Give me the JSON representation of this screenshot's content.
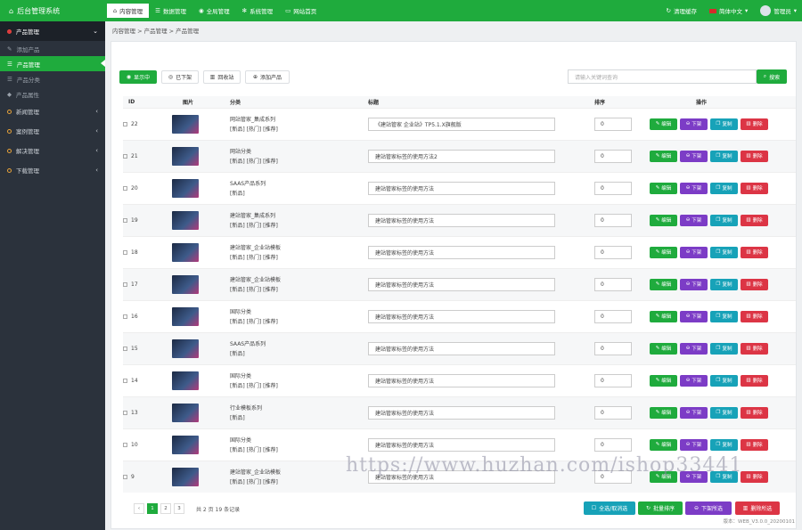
{
  "app_title": "后台管理系统",
  "top_nav": [
    {
      "label": "内容管理",
      "active": true
    },
    {
      "label": "数据管理",
      "active": false
    },
    {
      "label": "全局管理",
      "active": false
    },
    {
      "label": "系统管理",
      "active": false
    },
    {
      "label": "网站首页",
      "active": false
    }
  ],
  "top_right": {
    "clear_cache": "清理缓存",
    "language": "简体中文",
    "user": "管理员"
  },
  "sidebar": {
    "sections": [
      {
        "label": "产品管理",
        "open": true,
        "items": [
          {
            "label": "添加产品",
            "active": false
          },
          {
            "label": "产品管理",
            "active": true
          },
          {
            "label": "产品分类",
            "active": false
          },
          {
            "label": "产品属性",
            "active": false
          }
        ]
      },
      {
        "label": "新闻管理",
        "open": false,
        "items": []
      },
      {
        "label": "案例管理",
        "open": false,
        "items": []
      },
      {
        "label": "解决管理",
        "open": false,
        "items": []
      },
      {
        "label": "下载管理",
        "open": false,
        "items": []
      }
    ]
  },
  "breadcrumb": "内容管理  >  产品管理  >  产品管理",
  "toolbar": {
    "show": "显示中",
    "hidden": "已下架",
    "recycle": "回收站",
    "add": "添加产品"
  },
  "search": {
    "placeholder": "请输入关键词查询",
    "button": "搜索"
  },
  "table": {
    "columns": [
      "ID",
      "图片",
      "分类",
      "标题",
      "排序",
      "操作"
    ],
    "actions": {
      "edit": "编辑",
      "offline": "下架",
      "copy": "复制",
      "delete": "删除"
    },
    "rows": [
      {
        "id": "22",
        "category": "网站管家_集成系列",
        "tags": "[新品] [热门] [推荐]",
        "title": "《建站管家 企业站》TP5.1.X旗舰版",
        "sort": "0"
      },
      {
        "id": "21",
        "category": "网站分类",
        "tags": "[新品] [热门] [推荐]",
        "title": "建站管家标签的使用方法2",
        "sort": "0"
      },
      {
        "id": "20",
        "category": "SAAS产品系列",
        "tags": "[新品]",
        "title": "建站管家标签的使用方法",
        "sort": "0"
      },
      {
        "id": "19",
        "category": "建站管家_集成系列",
        "tags": "[新品] [热门] [推荐]",
        "title": "建站管家标签的使用方法",
        "sort": "0"
      },
      {
        "id": "18",
        "category": "建站管家_企业站模板",
        "tags": "[新品] [热门] [推荐]",
        "title": "建站管家标签的使用方法",
        "sort": "0"
      },
      {
        "id": "17",
        "category": "建站管家_企业站模板",
        "tags": "[新品] [热门] [推荐]",
        "title": "建站管家标签的使用方法",
        "sort": "0"
      },
      {
        "id": "16",
        "category": "国际分类",
        "tags": "[新品] [热门] [推荐]",
        "title": "建站管家标签的使用方法",
        "sort": "0"
      },
      {
        "id": "15",
        "category": "SAAS产品系列",
        "tags": "[新品]",
        "title": "建站管家标签的使用方法",
        "sort": "0"
      },
      {
        "id": "14",
        "category": "国际分类",
        "tags": "[新品] [热门] [推荐]",
        "title": "建站管家标签的使用方法",
        "sort": "0"
      },
      {
        "id": "13",
        "category": "行业模板系列",
        "tags": "[新品]",
        "title": "建站管家标签的使用方法",
        "sort": "0"
      },
      {
        "id": "10",
        "category": "国际分类",
        "tags": "[新品] [热门] [推荐]",
        "title": "建站管家标签的使用方法",
        "sort": "0"
      },
      {
        "id": "9",
        "category": "建站管家_企业站模板",
        "tags": "[新品] [热门] [推荐]",
        "title": "建站管家标签的使用方法",
        "sort": "0"
      }
    ]
  },
  "pagination": {
    "prev": "‹",
    "pages": [
      "1",
      "2",
      "3"
    ],
    "info": "共 2 页 19 条记录"
  },
  "bulk": {
    "select_all": "全选/取消选",
    "batch_sort": "批量排序",
    "batch_offline": "下架所选",
    "batch_delete": "删除所选"
  },
  "footer": "版本：WEB_V3.0.0_20200101",
  "watermark": "https://www.huzhan.com/ishop33441",
  "colors": {
    "accent": "#1fab3d",
    "sidebar": "#2b323c",
    "purple": "#7c3cc6",
    "teal": "#17a2b8",
    "red": "#dc3545"
  }
}
